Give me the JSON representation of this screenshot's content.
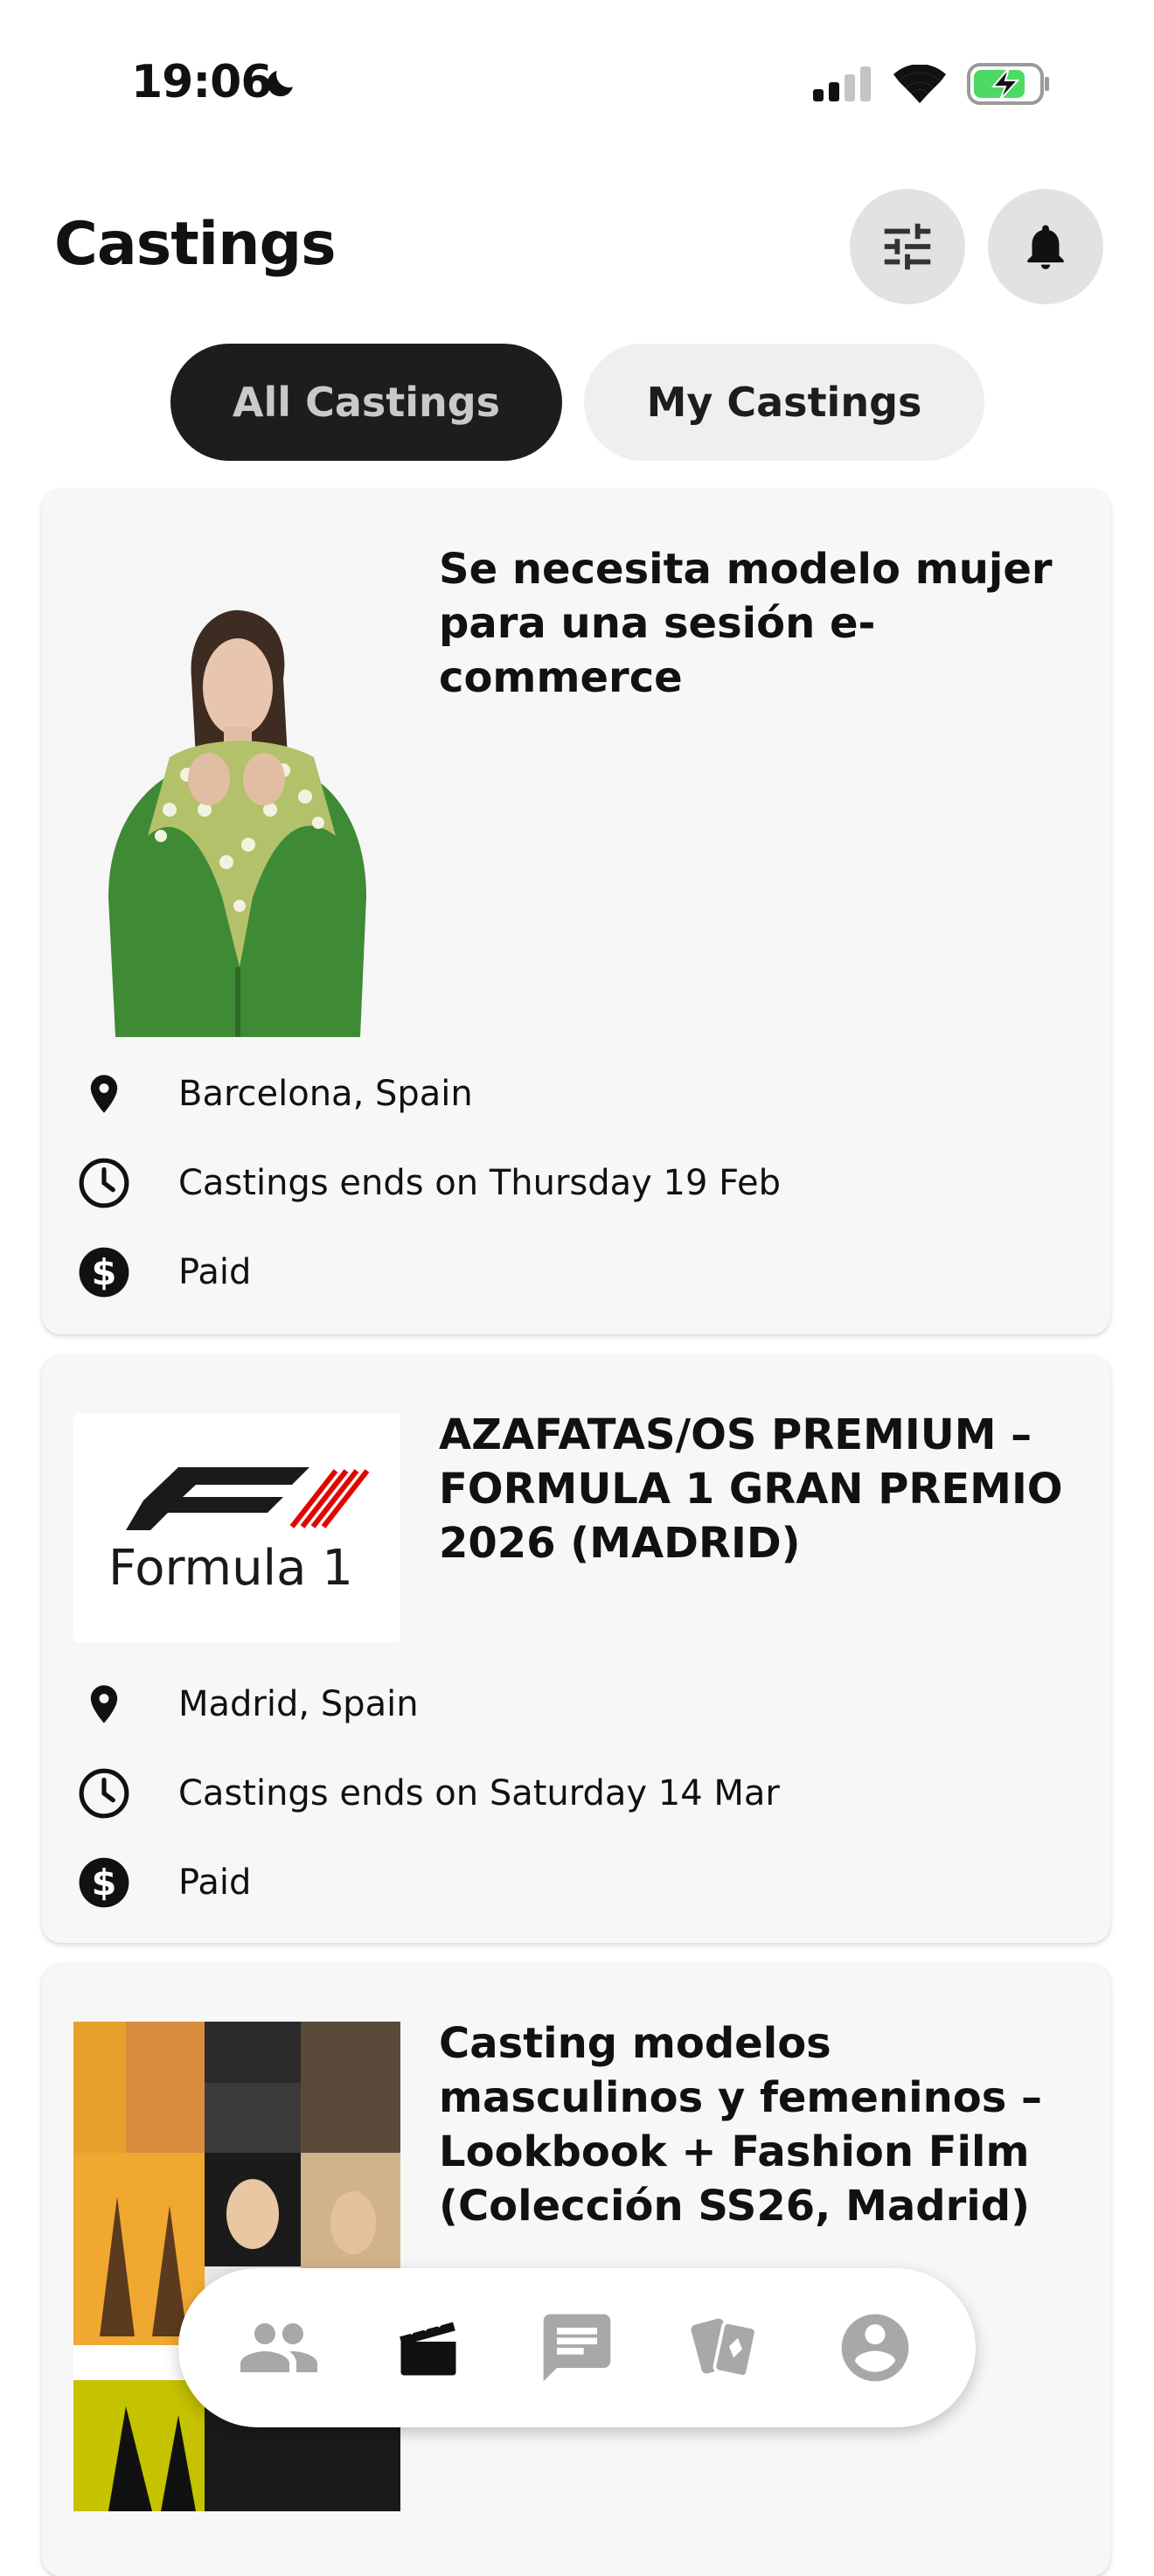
{
  "status_bar": {
    "time": "19:06"
  },
  "header": {
    "title": "Castings"
  },
  "tabs": [
    {
      "label": "All Castings",
      "active": true
    },
    {
      "label": "My Castings",
      "active": false
    }
  ],
  "cards": [
    {
      "title": "Se necesita modelo mujer para una sesión e-commerce",
      "location": "Barcelona, Spain",
      "ends": "Castings ends on Thursday 19 Feb",
      "payment": "Paid"
    },
    {
      "title": "AZAFATAS/OS PREMIUM – FORMULA 1 GRAN PREMIO 2026 (MADRID)",
      "location": "Madrid, Spain",
      "ends": "Castings ends on Saturday 14 Mar",
      "payment": "Paid",
      "logo_text": "Formula 1"
    },
    {
      "title": "Casting modelos masculinos y femeninos – Lookbook + Fashion Film (Colección SS26, Madrid)"
    }
  ],
  "bottom_nav": [
    "people-icon",
    "clapperboard-icon",
    "chat-icon",
    "cards-icon",
    "profile-icon"
  ],
  "colors": {
    "accent_dark": "#1d1d1d",
    "battery_green": "#4cd964",
    "card_bg": "#f7f7f7"
  }
}
